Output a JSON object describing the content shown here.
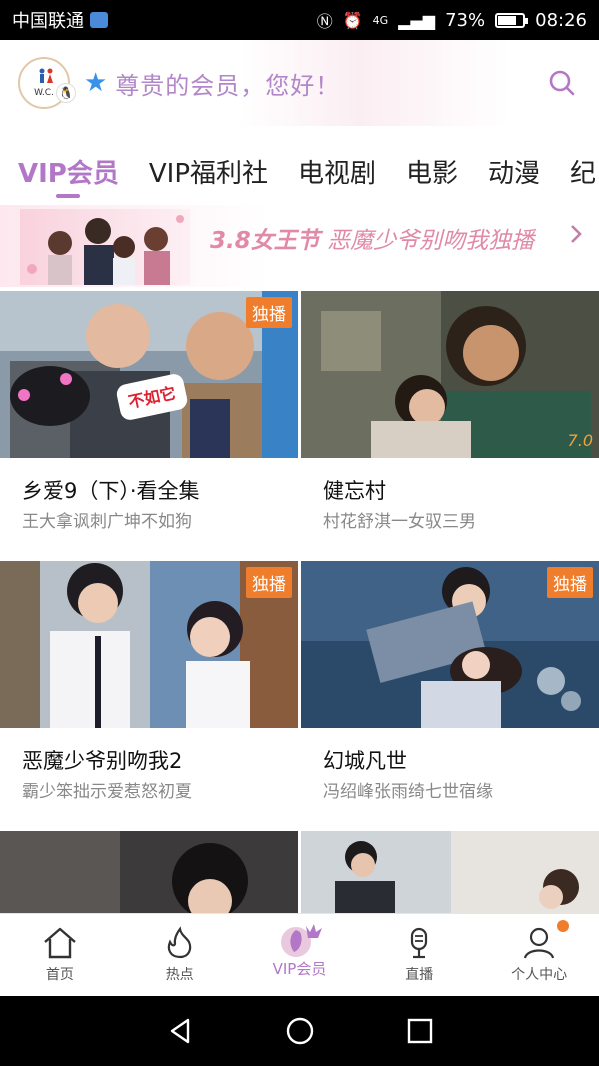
{
  "status_bar": {
    "carrier": "中国联通",
    "network": "4G",
    "battery": "73%",
    "battery_level": 0.73,
    "time": "08:26"
  },
  "header": {
    "avatar_text": "W.C.",
    "greeting": "尊贵的会员，您好！"
  },
  "tabs": [
    {
      "label": "VIP会员",
      "active": true
    },
    {
      "label": "VIP福利社",
      "active": false
    },
    {
      "label": "电视剧",
      "active": false
    },
    {
      "label": "电影",
      "active": false
    },
    {
      "label": "动漫",
      "active": false
    },
    {
      "label": "纪",
      "active": false
    }
  ],
  "banner": {
    "highlight": "3.8女王节",
    "text": "恶魔少爷别吻我独播"
  },
  "cards": [
    {
      "title": "乡爱9（下）·看全集",
      "subtitle": "王大拿讽刺广坤不如狗",
      "badge": "独播",
      "sticker": "不如它"
    },
    {
      "title": "健忘村",
      "subtitle": "村花舒淇一女驭三男",
      "score": "7.0"
    },
    {
      "title": "恶魔少爷别吻我2",
      "subtitle": "霸少笨拙示爱惹怒初夏",
      "badge": "独播"
    },
    {
      "title": "幻城凡世",
      "subtitle": "冯绍峰张雨绮七世宿缘",
      "badge": "独播"
    }
  ],
  "bottom_nav": [
    {
      "label": "首页",
      "icon": "home-icon"
    },
    {
      "label": "热点",
      "icon": "flame-icon"
    },
    {
      "label": "VIP会员",
      "icon": "vip-crown-icon",
      "active": true
    },
    {
      "label": "直播",
      "icon": "microphone-icon"
    },
    {
      "label": "个人中心",
      "icon": "person-icon",
      "has_notification": true
    }
  ],
  "colors": {
    "accent": "#b277c6",
    "badge": "#f07d2b",
    "banner_text": "#e08aa8",
    "greeting": "#b287c9"
  }
}
